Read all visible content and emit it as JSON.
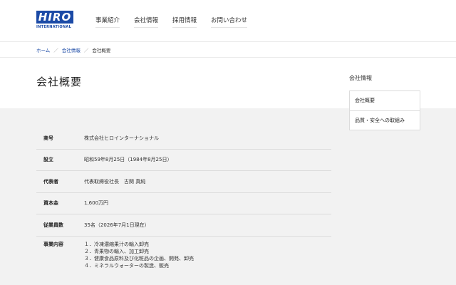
{
  "logo": {
    "main": "HIRO",
    "sub": "INTERNATIONAL"
  },
  "nav": [
    "事業紹介",
    "会社情報",
    "採用情報",
    "お問い合わせ"
  ],
  "breadcrumb": {
    "home": "ホーム",
    "section": "会社情報",
    "current": "会社概要",
    "separator": "／"
  },
  "page_title": "会社概要",
  "sidebar": {
    "heading": "会社情報",
    "items": [
      "会社概要",
      "品質・安全への取組み"
    ]
  },
  "table": {
    "rows": [
      {
        "label": "商号",
        "value": "株式会社ヒロインターナショナル"
      },
      {
        "label": "設立",
        "value": "昭和59年8月25日（1984年8月25日）"
      },
      {
        "label": "代表者",
        "value": "代表取締役社長　古関 真純"
      },
      {
        "label": "資本金",
        "value": "1,600万円"
      },
      {
        "label": "従業員数",
        "value": "35名（2026年7月1日現在）"
      }
    ],
    "business": {
      "label": "事業内容",
      "items": [
        "１．冷凍濃縮果汁の輸入卸売",
        "２．青果物の輸入、加工卸売",
        "３．健康食品原料及び化粧品の企画、開発、卸売",
        "４．ミネラルウォーターの製造、販売"
      ]
    }
  },
  "colors": {
    "brand": "#1b4aa6",
    "band": "#f2f2f2"
  }
}
